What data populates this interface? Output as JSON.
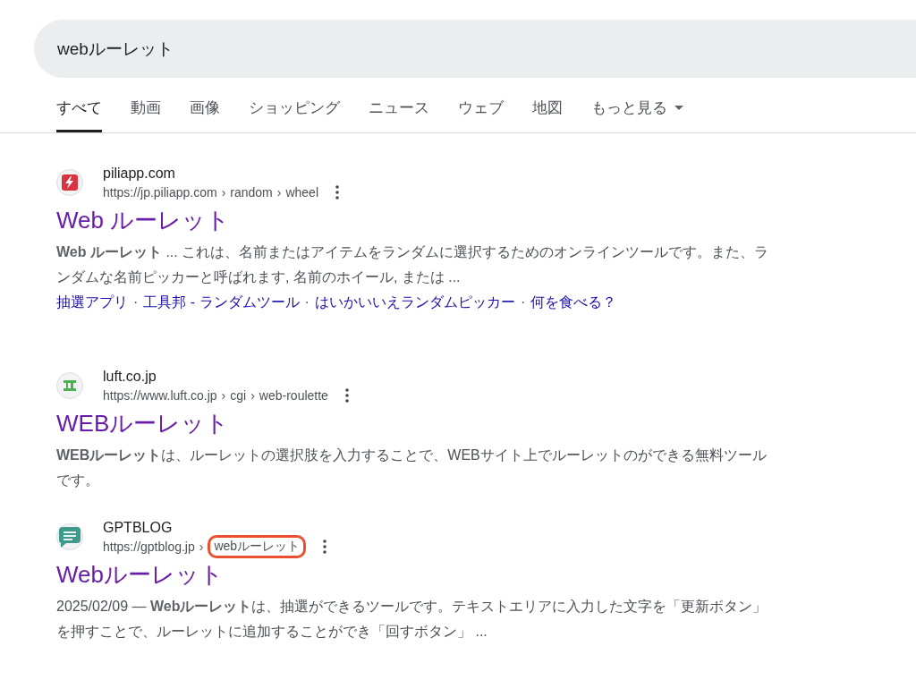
{
  "search": {
    "value": "webルーレット"
  },
  "tabs": [
    {
      "label": "すべて",
      "selected": true
    },
    {
      "label": "動画",
      "selected": false
    },
    {
      "label": "画像",
      "selected": false
    },
    {
      "label": "ショッピング",
      "selected": false
    },
    {
      "label": "ニュース",
      "selected": false
    },
    {
      "label": "ウェブ",
      "selected": false
    },
    {
      "label": "地図",
      "selected": false
    },
    {
      "label": "もっと見る",
      "selected": false,
      "dropdown": true
    }
  ],
  "results": [
    {
      "site": "piliapp.com",
      "favicon": {
        "kind": "bolt"
      },
      "separator": "›",
      "url": [
        {
          "text": "https://jp.piliapp.com",
          "highlighted": false
        },
        {
          "text": "random",
          "highlighted": false
        },
        {
          "text": "wheel",
          "highlighted": false
        }
      ],
      "title": "Web ルーレット",
      "snippet": "**Web ルーレット** ... これは、名前またはアイテムをランダムに選択するためのオンラインツールです。また、ランダムな名前ピッカーと呼ばれます, 名前のホイール, または ...",
      "sitelink_separator": "·",
      "sitelinks": [
        "抽選アプリ",
        "工具邦 - ランダムツール",
        "はいかいいえランダムピッカー",
        "何を食べる？"
      ]
    },
    {
      "site": "luft.co.jp",
      "favicon": {
        "kind": "bracket"
      },
      "separator": "›",
      "url": [
        {
          "text": "https://www.luft.co.jp",
          "highlighted": false
        },
        {
          "text": "cgi",
          "highlighted": false
        },
        {
          "text": "web-roulette",
          "highlighted": false
        }
      ],
      "title": "WEBルーレット",
      "snippet": "**WEBルーレット**は、ルーレットの選択肢を入力することで、WEBサイト上でルーレットのができる無料ツールです。"
    },
    {
      "site": "GPTBLOG",
      "favicon": {
        "kind": "chat"
      },
      "separator": "›",
      "url": [
        {
          "text": "https://gptblog.jp",
          "highlighted": false
        },
        {
          "text": "webルーレット",
          "highlighted": true
        }
      ],
      "title": "Webルーレット",
      "snippet": "2025/02/09 — **Webルーレット**は、抽選ができるツールです。テキストエリアに入力した文字を「更新ボタン」を押すことで、ルーレットに追加することができ「回すボタン」 ..."
    }
  ]
}
